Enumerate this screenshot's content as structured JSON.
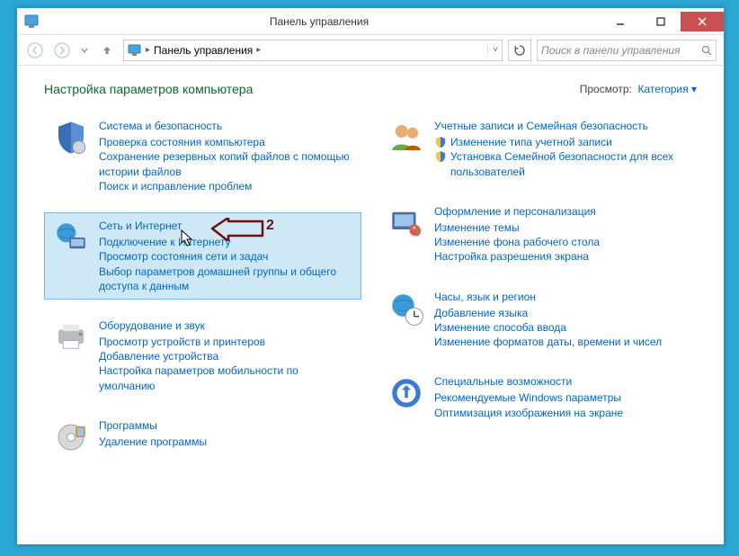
{
  "window": {
    "title": "Панель управления"
  },
  "breadcrumb": {
    "item1": "Панель управления"
  },
  "search": {
    "placeholder": "Поиск в панели управления"
  },
  "header": {
    "title": "Настройка параметров компьютера",
    "view_label": "Просмотр:",
    "view_value": "Категория"
  },
  "annotation": {
    "label": "2"
  },
  "categories": {
    "system": {
      "title": "Система и безопасность",
      "links": [
        "Проверка состояния компьютера",
        "Сохранение резервных копий файлов с помощью истории файлов",
        "Поиск и исправление проблем"
      ]
    },
    "network": {
      "title": "Сеть и Интернет",
      "links": [
        "Подключение к Интернету",
        "Просмотр состояния сети и задач",
        "Выбор параметров домашней группы и общего доступа к данным"
      ]
    },
    "hardware": {
      "title": "Оборудование и звук",
      "links": [
        "Просмотр устройств и принтеров",
        "Добавление устройства",
        "Настройка параметров мобильности по умолчанию"
      ]
    },
    "programs": {
      "title": "Программы",
      "links": [
        "Удаление программы"
      ]
    },
    "users": {
      "title": "Учетные записи и Семейная безопасность",
      "links": [
        "Изменение типа учетной записи",
        "Установка Семейной безопасности для всех пользователей"
      ]
    },
    "appearance": {
      "title": "Оформление и персонализация",
      "links": [
        "Изменение темы",
        "Изменение фона рабочего стола",
        "Настройка разрешения экрана"
      ]
    },
    "clock": {
      "title": "Часы, язык и регион",
      "links": [
        "Добавление языка",
        "Изменение способа ввода",
        "Изменение форматов даты, времени и чисел"
      ]
    },
    "access": {
      "title": "Специальные возможности",
      "links": [
        "Рекомендуемые Windows параметры",
        "Оптимизация изображения на экране"
      ]
    }
  }
}
